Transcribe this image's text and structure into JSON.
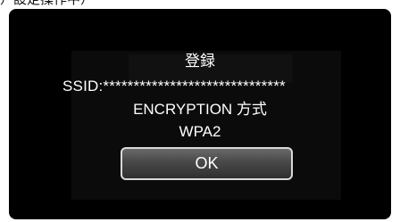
{
  "page": {
    "top_caption": "）設定操作中）"
  },
  "dialog": {
    "title": "登録",
    "ssid": "SSID:******************************",
    "encryption": "ENCRYPTION 方式",
    "encryption_value": "WPA2",
    "ok_label": "OK"
  },
  "colors": {
    "screen_background": "#000000",
    "text": "#ffffff",
    "button_fill": "#4b4b4b",
    "button_border": "#d9d9d9"
  }
}
